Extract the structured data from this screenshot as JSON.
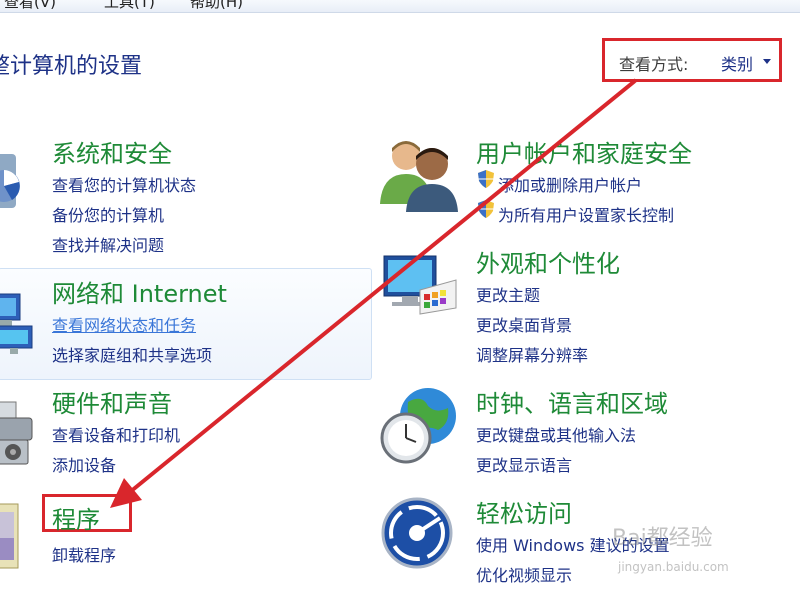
{
  "menubar": {
    "items": [
      "查看(V)",
      "工具(T)",
      "帮助(H)"
    ]
  },
  "page_title": "整计算机的设置",
  "view_by": {
    "label": "查看方式:",
    "value": "类别"
  },
  "categories": [
    {
      "title": "系统和安全",
      "links": [
        "查看您的计算机状态",
        "备份您的计算机",
        "查找并解决问题"
      ]
    },
    {
      "title": "网络和 Internet",
      "links": [
        "查看网络状态和任务",
        "选择家庭组和共享选项"
      ]
    },
    {
      "title": "硬件和声音",
      "links": [
        "查看设备和打印机",
        "添加设备"
      ]
    },
    {
      "title": "程序",
      "links": [
        "卸载程序"
      ]
    },
    {
      "title": "用户帐户和家庭安全",
      "links": [
        "添加或删除用户帐户",
        "为所有用户设置家长控制"
      ]
    },
    {
      "title": "外观和个性化",
      "links": [
        "更改主题",
        "更改桌面背景",
        "调整屏幕分辨率"
      ]
    },
    {
      "title": "时钟、语言和区域",
      "links": [
        "更改键盘或其他输入法",
        "更改显示语言"
      ]
    },
    {
      "title": "轻松访问",
      "links": [
        "使用 Windows 建议的设置",
        "优化视频显示"
      ]
    }
  ],
  "watermark": {
    "text": "Bai都经验",
    "sub": "jingyan.baidu.com"
  },
  "colors": {
    "title_green": "#1e8a37",
    "link_blue": "#1e3287",
    "annotation_red": "#d9262c"
  }
}
